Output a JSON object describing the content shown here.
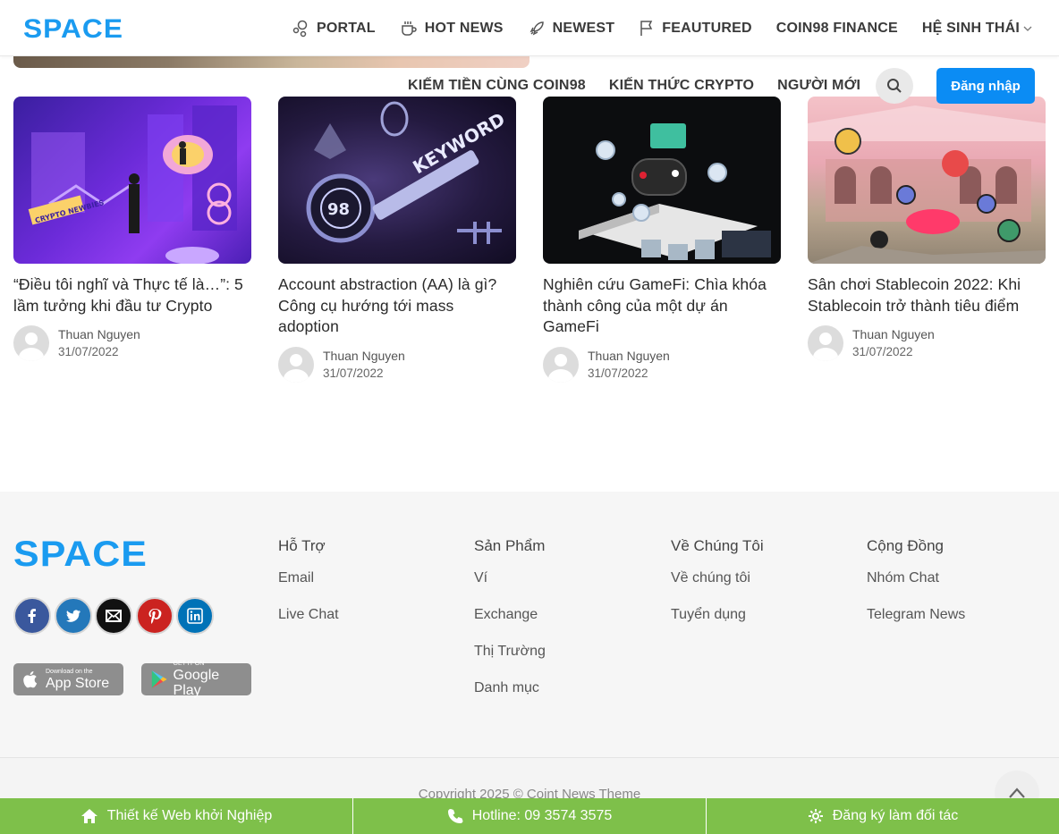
{
  "brand": {
    "logo_text": "SPACE",
    "logo_color": "#1a9bf0"
  },
  "nav": {
    "items": [
      {
        "label": "PORTAL",
        "icon": "bubbles-icon"
      },
      {
        "label": "HOT NEWS",
        "icon": "cup-icon"
      },
      {
        "label": "NEWEST",
        "icon": "rocket-icon"
      },
      {
        "label": "FEAUTURED",
        "icon": "flag-icon"
      },
      {
        "label": "COIN98 FINANCE",
        "icon": ""
      },
      {
        "label": "HỆ SINH THÁI",
        "icon": "chevron-down-icon"
      }
    ],
    "row2": [
      {
        "label": "KIẾM TIỀN CÙNG COIN98"
      },
      {
        "label": "KIẾN THỨC CRYPTO"
      },
      {
        "label": "NGƯỜI MỚI"
      }
    ],
    "login_label": "Đăng nhập"
  },
  "articles": [
    {
      "title": "“Điều tôi nghĩ và Thực tế là…”: 5 lầm tưởng khi đầu tư Crypto",
      "author": "Thuan Nguyen",
      "date": "31/07/2022",
      "thumb_text": "CRYPTO NEWBIES"
    },
    {
      "title": "Account abstraction (AA) là gì? Công cụ hướng tới mass adoption",
      "author": "Thuan Nguyen",
      "date": "31/07/2022",
      "thumb_text": "KEYWORD"
    },
    {
      "title": "Nghiên cứu GameFi: Chìa khóa thành công của một dự án GameFi",
      "author": "Thuan Nguyen",
      "date": "31/07/2022",
      "thumb_text": ""
    },
    {
      "title": "Sân chơi Stablecoin 2022: Khi Stablecoin trở thành tiêu điểm",
      "author": "Thuan Nguyen",
      "date": "31/07/2022",
      "thumb_text": ""
    }
  ],
  "footer": {
    "socials": [
      {
        "name": "facebook",
        "icon": "facebook-icon",
        "color": "#3a589d"
      },
      {
        "name": "twitter",
        "icon": "twitter-icon",
        "color": "#2478ba"
      },
      {
        "name": "email",
        "icon": "envelope-icon",
        "color": "#111111"
      },
      {
        "name": "pinterest",
        "icon": "pinterest-icon",
        "color": "#cb2320"
      },
      {
        "name": "linkedin",
        "icon": "linkedin-icon",
        "color": "#0072b7"
      }
    ],
    "apps": {
      "appstore_small": "Download on the",
      "appstore_big": "App Store",
      "googleplay_small": "GET IT ON",
      "googleplay_big": "Google Play"
    },
    "columns": [
      {
        "heading": "Hỗ Trợ",
        "links": [
          "Email",
          "Live Chat"
        ]
      },
      {
        "heading": "Sản Phẩm",
        "links": [
          "Ví",
          "Exchange",
          "Thị Trường",
          "Danh mục"
        ]
      },
      {
        "heading": "Về Chúng Tôi",
        "links": [
          "Về chúng tôi",
          "Tuyển dụng"
        ]
      },
      {
        "heading": "Cộng Đồng",
        "links": [
          "Nhóm Chat",
          "Telegram News"
        ]
      }
    ],
    "copyright": "Copyright 2025 © Coint News Theme"
  },
  "bottom_bar": {
    "items": [
      {
        "label": "Thiết kế Web khởi Nghiệp",
        "icon": "home-icon"
      },
      {
        "label": "Hotline: 09 3574 3575",
        "icon": "phone-icon"
      },
      {
        "label": "Đăng ký làm đối tác",
        "icon": "gear-icon"
      }
    ],
    "color": "#7ec04a"
  }
}
